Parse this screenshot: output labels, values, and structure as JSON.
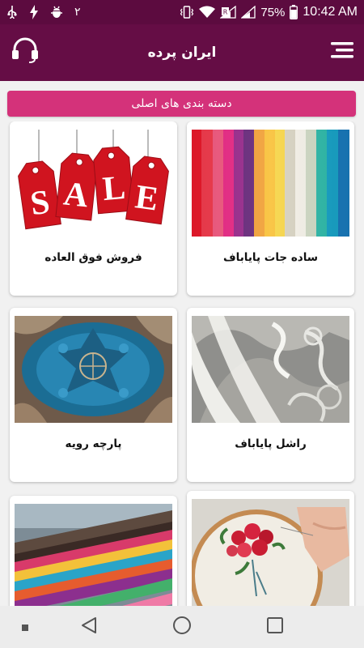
{
  "status_bar": {
    "notification_digit": "٢",
    "battery_percent": "75%",
    "time": "10:42 AM"
  },
  "app_bar": {
    "title": "ایران پرده"
  },
  "category_banner": {
    "label": "دسته بندی های اصلی"
  },
  "categories": [
    {
      "label": "ساده جات پایاباف",
      "image": "colorful-fabric-rolls"
    },
    {
      "label": "فروش فوق العاده",
      "image": "sale-tags"
    },
    {
      "label": "راشل پایاباف",
      "image": "lace-curtain"
    },
    {
      "label": "پارچه رویه",
      "image": "blue-damask-fabric"
    },
    {
      "label": "",
      "image": "embroidery-hoop"
    },
    {
      "label": "",
      "image": "fabric-swatches"
    }
  ],
  "sale_tag_letters": [
    "S",
    "A",
    "L",
    "E"
  ],
  "colors": {
    "status_bar": "#5c0b3f",
    "app_bar": "#650d45",
    "banner": "#d4327a",
    "background": "#f1f1f1"
  }
}
